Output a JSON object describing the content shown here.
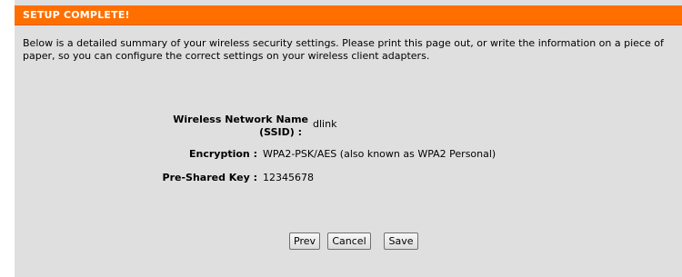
{
  "header": {
    "title": "SETUP COMPLETE!"
  },
  "intro": {
    "text": "Below is a detailed summary of your wireless security settings. Please print this page out, or write the information on a piece of paper, so you can configure the correct settings on your wireless client adapters."
  },
  "summary": {
    "ssid_label_line1": "Wireless Network Name",
    "ssid_label_line2": "(SSID) :",
    "ssid_value": "dlink",
    "encryption_label": "Encryption :",
    "encryption_value": "WPA2-PSK/AES (also known as WPA2 Personal)",
    "psk_label": "Pre-Shared Key :",
    "psk_value": "12345678"
  },
  "buttons": {
    "prev": "Prev",
    "cancel": "Cancel",
    "save": "Save"
  },
  "colors": {
    "header_bg": "#ff6f00",
    "panel_bg": "#dfdfdf"
  }
}
